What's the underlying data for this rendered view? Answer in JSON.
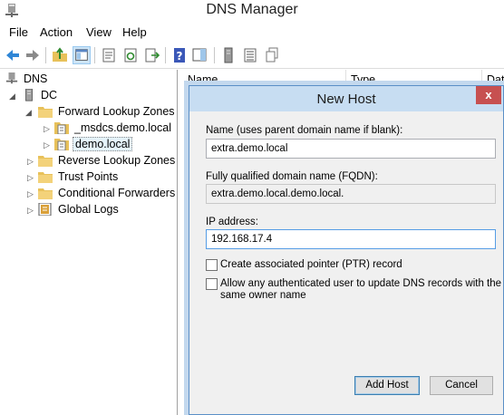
{
  "window": {
    "title": "DNS Manager"
  },
  "menu": [
    "File",
    "Action",
    "View",
    "Help"
  ],
  "tree": {
    "root": "DNS",
    "server": "DC",
    "forward_zones": "Forward Lookup Zones",
    "msdcs_zone": "_msdcs.demo.local",
    "demo_zone": "demo.local",
    "reverse_zones": "Reverse Lookup Zones",
    "trust_points": "Trust Points",
    "conditional_forwarders": "Conditional Forwarders",
    "global_logs": "Global Logs"
  },
  "list": {
    "columns": [
      "Name",
      "Type",
      "Dat"
    ]
  },
  "dialog": {
    "title": "New Host",
    "close_label": "x",
    "name_label": "Name (uses parent domain name if blank):",
    "name_value": "extra.demo.local",
    "fqdn_label": "Fully qualified domain name (FQDN):",
    "fqdn_value": "extra.demo.local.demo.local.",
    "ip_label": "IP address:",
    "ip_value": "192.168.17.4",
    "ptr_label": "Create associated pointer (PTR) record",
    "ptr_checked": false,
    "update_label_1": "Allow any authenticated user to update DNS records with the",
    "update_label_2": "same owner name",
    "update_checked": false,
    "add_host_label": "Add Host",
    "cancel_label": "Cancel"
  },
  "colors": {
    "dialog_title_bg": "#c7ddf2",
    "close_bg": "#c75050",
    "folder": "#e8c15a"
  }
}
